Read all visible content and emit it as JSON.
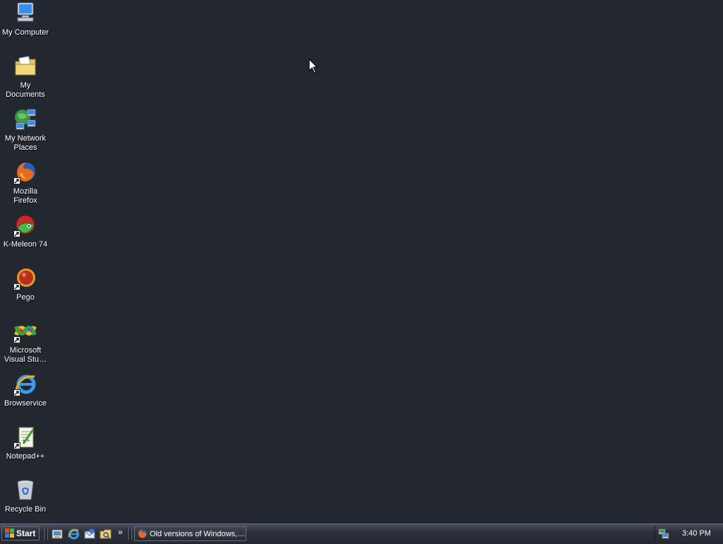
{
  "desktop": {
    "icons": [
      {
        "label": "My Computer",
        "icon": "computer-icon",
        "shortcut": false
      },
      {
        "label": "My Documents",
        "icon": "documents-folder-icon",
        "shortcut": false
      },
      {
        "label": "My Network\nPlaces",
        "icon": "network-places-icon",
        "shortcut": false
      },
      {
        "label": "Mozilla Firefox",
        "icon": "firefox-icon",
        "shortcut": true
      },
      {
        "label": "K-Meleon 74",
        "icon": "kmeleon-icon",
        "shortcut": true
      },
      {
        "label": "Pego",
        "icon": "pego-icon",
        "shortcut": true
      },
      {
        "label": "Microsoft\nVisual Stu…",
        "icon": "visual-studio-icon",
        "shortcut": true
      },
      {
        "label": "Browservice",
        "icon": "internet-explorer-icon",
        "shortcut": true
      },
      {
        "label": "Notepad++",
        "icon": "notepadpp-icon",
        "shortcut": true
      },
      {
        "label": "Recycle Bin",
        "icon": "recycle-bin-icon",
        "shortcut": false
      }
    ]
  },
  "taskbar": {
    "start_label": "Start",
    "quick_launch": [
      "show-desktop-icon",
      "internet-explorer-icon",
      "outlook-express-icon",
      "windows-explorer-icon"
    ],
    "overflow_label": "»",
    "task_button_label": "Old versions of Windows,…",
    "clock": "3:40 PM"
  },
  "colors": {
    "desktop_background": "#232830",
    "taskbar": "#2b303a",
    "text": "#ffffff"
  }
}
